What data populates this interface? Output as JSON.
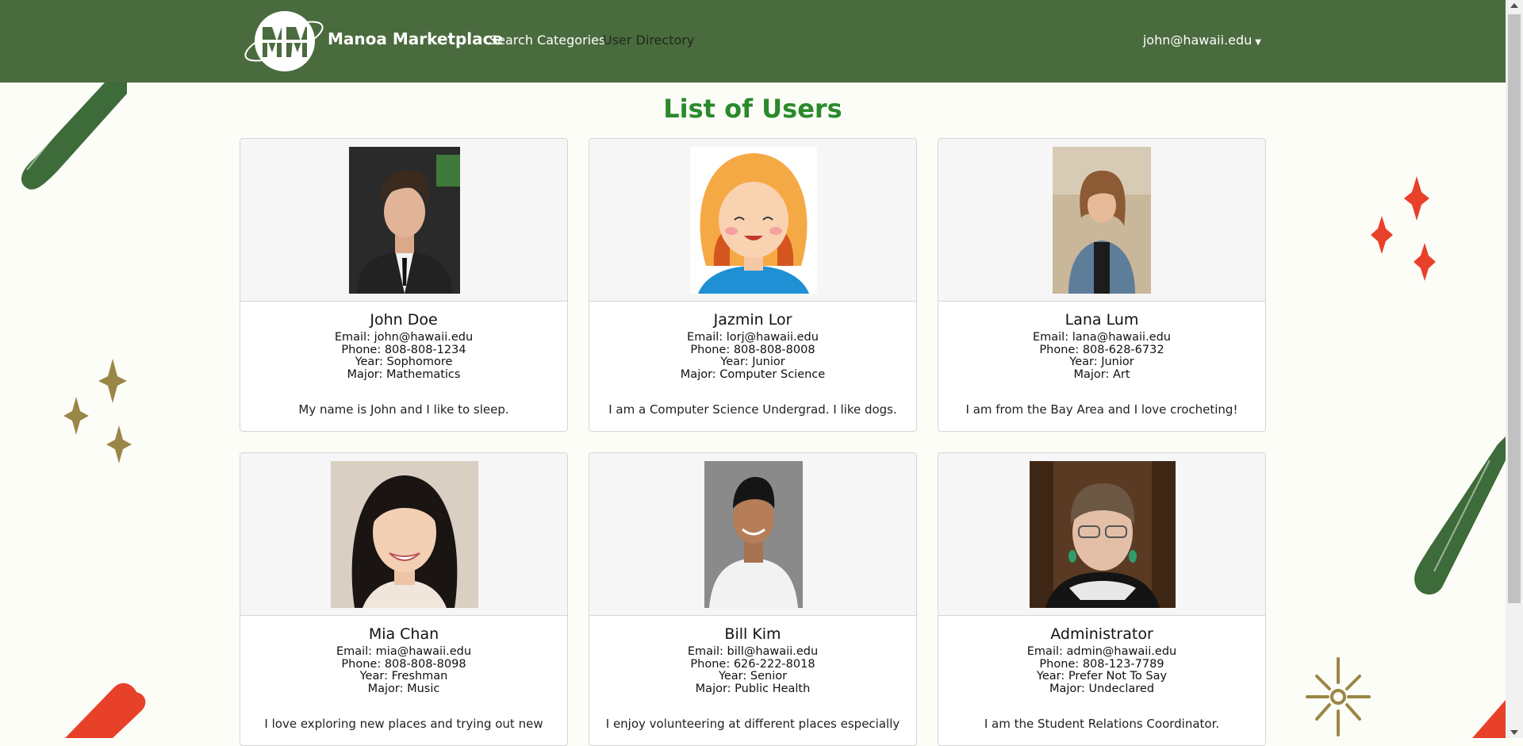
{
  "navbar": {
    "brand": "Manoa Marketplace",
    "logo_text": "Manoa Marketplace",
    "links": [
      "Search Categories",
      "User Directory"
    ],
    "user": "john@hawaii.edu"
  },
  "page": {
    "title": "List of Users"
  },
  "users": [
    {
      "name": "John Doe",
      "email": "Email: john@hawaii.edu",
      "phone": "Phone: 808-808-1234",
      "year": "Year: Sophomore",
      "major": "Major: Mathematics",
      "bio": "My name is John and I like to sleep."
    },
    {
      "name": "Jazmin Lor",
      "email": "Email: lorj@hawaii.edu",
      "phone": "Phone: 808-808-8008",
      "year": "Year: Junior",
      "major": "Major: Computer Science",
      "bio": "I am a Computer Science Undergrad. I like dogs."
    },
    {
      "name": "Lana Lum",
      "email": "Email: lana@hawaii.edu",
      "phone": "Phone: 808-628-6732",
      "year": "Year: Junior",
      "major": "Major: Art",
      "bio": "I am from the Bay Area and I love crocheting!"
    },
    {
      "name": "Mia Chan",
      "email": "Email: mia@hawaii.edu",
      "phone": "Phone: 808-808-8098",
      "year": "Year: Freshman",
      "major": "Major: Music",
      "bio": "I love exploring new places and trying out new"
    },
    {
      "name": "Bill Kim",
      "email": "Email: bill@hawaii.edu",
      "phone": "Phone: 626-222-8018",
      "year": "Year: Senior",
      "major": "Major: Public Health",
      "bio": "I enjoy volunteering at different places especially"
    },
    {
      "name": "Administrator",
      "email": "Email: admin@hawaii.edu",
      "phone": "Phone: 808-123-7789",
      "year": "Year: Prefer Not To Say",
      "major": "Major: Undeclared",
      "bio": "I am the Student Relations Coordinator."
    }
  ],
  "colors": {
    "nav": "#4a6b3d",
    "title": "#2b8a2b",
    "accent_red": "#e8412a",
    "accent_gold": "#9a8747",
    "accent_green": "#3d6b3a"
  }
}
